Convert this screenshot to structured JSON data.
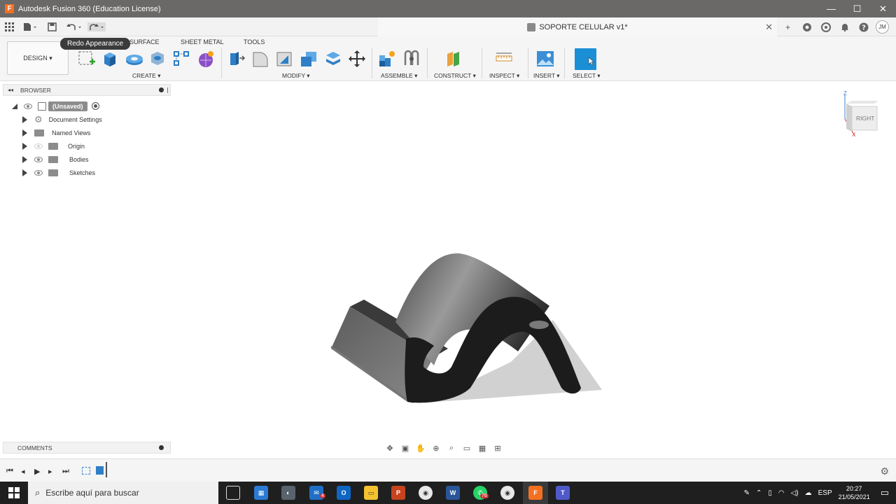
{
  "window": {
    "title": "Autodesk Fusion 360 (Education License)",
    "logo_letter": "F",
    "minimize": "—",
    "maximize": "☐",
    "close": "✕"
  },
  "tabbar": {
    "document_title": "SOPORTE CELULAR v1*",
    "tab_close": "✕",
    "new_tab": "+",
    "user_initials": "JM",
    "help": "?"
  },
  "ribbon": {
    "workspace": "DESIGN ▾",
    "tabs": [
      "SURFACE",
      "SHEET METAL",
      "TOOLS"
    ],
    "groups": {
      "create": "CREATE ▾",
      "modify": "MODIFY ▾",
      "assemble": "ASSEMBLE ▾",
      "construct": "CONSTRUCT ▾",
      "inspect": "INSPECT ▾",
      "insert": "INSERT ▾",
      "select": "SELECT ▾"
    },
    "tooltip": "Redo Appearance"
  },
  "browser": {
    "title": "BROWSER",
    "root": "(Unsaved)",
    "items": [
      "Document Settings",
      "Named Views",
      "Origin",
      "Bodies",
      "Sketches"
    ]
  },
  "viewcube": {
    "face": "RIGHT",
    "axis_z": "Z",
    "axis_x": "X"
  },
  "comments": {
    "title": "COMMENTS"
  },
  "taskbar": {
    "search_placeholder": "Escribe aquí para buscar",
    "mail_badge": "4",
    "whatsapp_badge": "76",
    "language": "ESP",
    "time": "20:27",
    "date": "21/05/2021"
  },
  "colors": {
    "titlebar": "#6b6868",
    "accent_blue": "#1a8fd6",
    "fusion_orange": "#f37021",
    "model_dark": "#1c1c1c"
  }
}
